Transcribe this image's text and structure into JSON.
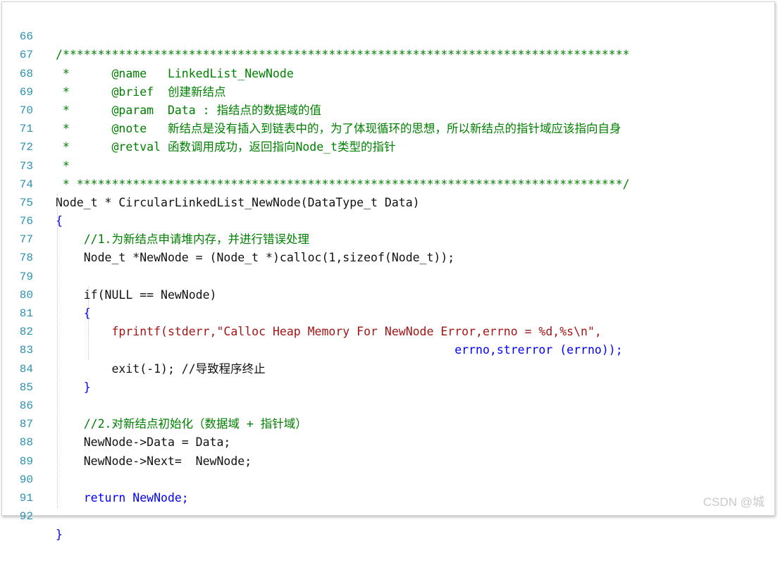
{
  "lines": [
    {
      "n": "66",
      "t": "/*********************************************************************************"
    },
    {
      "n": "67",
      "t": " *      @name   LinkedList_NewNode"
    },
    {
      "n": "68",
      "t": " *      @brief  创建新结点"
    },
    {
      "n": "69",
      "t": " *      @param  Data : 指结点的数据域的值"
    },
    {
      "n": "70",
      "t": " *      @note   新结点是没有插入到链表中的，为了体现循环的思想，所以新结点的指针域应该指向自身"
    },
    {
      "n": "71",
      "t": " *      @retval 函数调用成功，返回指向Node_t类型的指针"
    },
    {
      "n": "72",
      "t": " *"
    },
    {
      "n": "73",
      "t": " * ******************************************************************************/"
    },
    {
      "n": "74",
      "t": "Node_t * CircularLinkedList_NewNode(DataType_t Data)"
    },
    {
      "n": "75",
      "t": "{"
    },
    {
      "n": "76",
      "t": "    //1.为新结点申请堆内存，并进行错误处理"
    },
    {
      "n": "77",
      "t": "    Node_t *NewNode = (Node_t *)calloc(1,sizeof(Node_t));"
    },
    {
      "n": "78",
      "t": ""
    },
    {
      "n": "79",
      "t": "    if(NULL == NewNode)"
    },
    {
      "n": "80",
      "t": "    {"
    },
    {
      "n": "81",
      "t": "        fprintf(stderr,\"Calloc Heap Memory For NewNode Error,errno = %d,%s\\n\","
    },
    {
      "n": "82",
      "t": "                                                         errno,strerror (errno));"
    },
    {
      "n": "83",
      "t": "        exit(-1); //导致程序终止"
    },
    {
      "n": "84",
      "t": "    }"
    },
    {
      "n": "85",
      "t": ""
    },
    {
      "n": "86",
      "t": "    //2.对新结点初始化（数据域 + 指针域）"
    },
    {
      "n": "87",
      "t": "    NewNode->Data = Data;"
    },
    {
      "n": "88",
      "t": "    NewNode->Next=  NewNode;"
    },
    {
      "n": "89",
      "t": ""
    },
    {
      "n": "90",
      "t": "    return NewNode;"
    },
    {
      "n": "91",
      "t": ""
    },
    {
      "n": "92",
      "t": "}"
    }
  ],
  "watermark": "CSDN @城",
  "colors": {
    "line_number": "#2b91af",
    "comment": "#008000",
    "keyword": "#0000ff",
    "string": "#a31515",
    "text": "#111111"
  }
}
